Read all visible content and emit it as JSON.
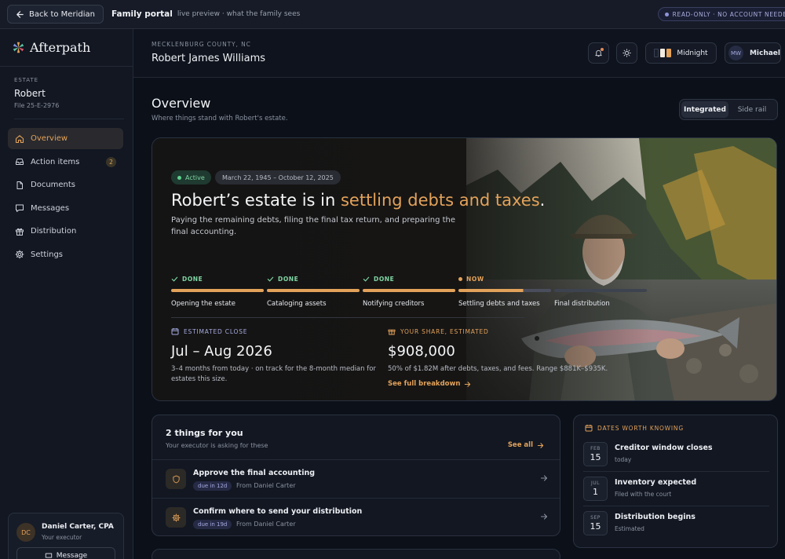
{
  "topbar": {
    "back_label": "Back to Meridian",
    "title": "Family portal",
    "subtitle": "live preview · what the family sees",
    "readonly_badge": "READ-ONLY · NO ACCOUNT NEEDED"
  },
  "sidebar": {
    "brand": "Afterpath",
    "estate_label": "ESTATE",
    "estate_name": "Robert",
    "file_no": "File 25-E-2976",
    "nav": [
      {
        "label": "Overview",
        "icon": "home-icon",
        "active": true
      },
      {
        "label": "Action items",
        "icon": "inbox-icon",
        "badge": "2"
      },
      {
        "label": "Documents",
        "icon": "document-icon"
      },
      {
        "label": "Messages",
        "icon": "message-icon"
      },
      {
        "label": "Distribution",
        "icon": "gift-icon"
      },
      {
        "label": "Settings",
        "icon": "gear-icon"
      }
    ],
    "executor": {
      "initials": "DC",
      "name": "Daniel Carter, CPA",
      "role": "Your executor",
      "message_label": "Message"
    }
  },
  "header": {
    "county": "MECKLENBURG COUNTY, NC",
    "deceased": "Robert James Williams",
    "theme_label": "Midnight",
    "user_initials": "MW",
    "user_name": "Michael"
  },
  "overview": {
    "title": "Overview",
    "subtitle": "Where things stand with Robert's estate.",
    "view_modes": [
      "Integrated",
      "Side rail"
    ],
    "active_mode": "Integrated"
  },
  "hero": {
    "status": "Active",
    "dates": "March 22, 1945 – October 12, 2025",
    "headline_prefix": "Robert’s estate is in ",
    "headline_accent": "settling debts and taxes",
    "headline_suffix": ".",
    "description": "Paying the remaining debts, filing the final tax return, and preparing the final accounting.",
    "stages": [
      {
        "state": "DONE",
        "label": "Opening the estate",
        "progress": 1.0
      },
      {
        "state": "DONE",
        "label": "Cataloging assets",
        "progress": 1.0
      },
      {
        "state": "DONE",
        "label": "Notifying creditors",
        "progress": 1.0
      },
      {
        "state": "NOW",
        "label": "Settling debts and taxes",
        "progress": 0.7
      },
      {
        "state": "",
        "label": "Final distribution",
        "progress": 0.0
      }
    ],
    "estimated_close": {
      "label": "ESTIMATED CLOSE",
      "value": "Jul – Aug 2026",
      "note": "3–4 months from today · on track for the 8-month median for estates this size."
    },
    "your_share": {
      "label": "YOUR SHARE, ESTIMATED",
      "value": "$908,000",
      "note": "50% of $1.82M after debts, taxes, and fees. Range $881K–$935K.",
      "link": "See full breakdown"
    }
  },
  "things": {
    "title": "2 things for you",
    "subtitle": "Your executor is asking for these",
    "see_all": "See all",
    "items": [
      {
        "title": "Approve the final accounting",
        "due": "due in 12d",
        "from": "From Daniel Carter",
        "icon": "shield-icon"
      },
      {
        "title": "Confirm where to send your distribution",
        "due": "due in 19d",
        "from": "From Daniel Carter",
        "icon": "gear-icon"
      }
    ]
  },
  "dates": {
    "title": "DATES WORTH KNOWING",
    "items": [
      {
        "month": "FEB",
        "day": "15",
        "title": "Creditor window closes",
        "note": "today"
      },
      {
        "month": "JUL",
        "day": "1",
        "title": "Inventory expected",
        "note": "Filed with the court"
      },
      {
        "month": "SEP",
        "day": "15",
        "title": "Distribution begins",
        "note": "Estimated"
      }
    ]
  },
  "colors": {
    "accent": "#e3a25a",
    "success": "#7fd6a4",
    "background": "#0b1019",
    "panel": "#121722"
  }
}
